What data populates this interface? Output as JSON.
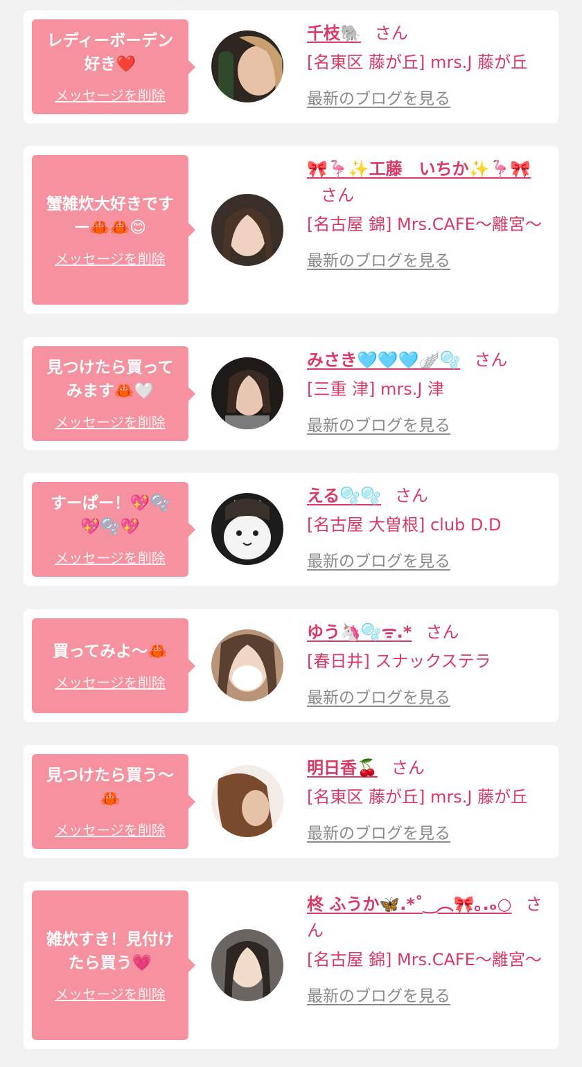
{
  "common": {
    "delete_label": "メッセージを削除",
    "blog_label": "最新のブログを見る",
    "san_label": "さん"
  },
  "messages": [
    {
      "message": "レディーボーデン\n好き❤️",
      "name": "千枝🐘",
      "shop": "[名東区 藤が丘] mrs.J 藤が丘",
      "avatar_color": "#6b5a4a"
    },
    {
      "message": "蟹雑炊大好きです\nー🦀🦀😊",
      "name": "🎀🦩✨工藤　いちか✨🦩🎀",
      "shop": "[名古屋 錦] Mrs.CAFE〜離宮〜",
      "avatar_color": "#5b4a40"
    },
    {
      "message": "見つけたら買って\nみます🦀🤍",
      "name": "みさき🩵🩵🩵🪽🫧",
      "shop": "[三重 津] mrs.J 津",
      "avatar_color": "#3d3430"
    },
    {
      "message": "すーぱー！💖🫧\n💖🫧💖",
      "name": "える🫧🫧",
      "shop": "[名古屋 大曽根] club D.D",
      "avatar_color": "#2a2a2a"
    },
    {
      "message": "買ってみよ〜🦀",
      "name": "ゆう🦄🫧ᯤ.*",
      "shop": "[春日井] スナックステラ",
      "avatar_color": "#8a6c55"
    },
    {
      "message": "見つけたら買う〜\n🦀",
      "name": "明日香🍒",
      "shop": "[名東区 藤が丘] mrs.J 藤が丘",
      "avatar_color": "#7a5438"
    },
    {
      "message": "雑炊すき！見付け\nたら買う💗",
      "name": "柊 ふうか🦋.*˚‿︵🎀｡.ₒ○",
      "shop": "[名古屋 錦] Mrs.CAFE〜離宮〜",
      "avatar_color": "#4d4540"
    }
  ]
}
